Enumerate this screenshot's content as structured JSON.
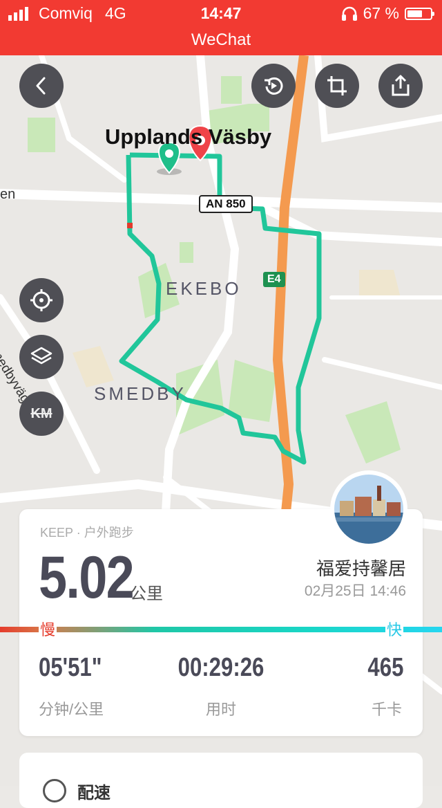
{
  "status_bar": {
    "carrier": "Comviq",
    "network": "4G",
    "time": "14:47",
    "battery_text": "67 %",
    "battery_level": 0.67,
    "app_title": "WeChat"
  },
  "map": {
    "place_title": "Upplands Väsby",
    "areas": [
      "EKEBO",
      "SMEDBY"
    ],
    "street_labels": [
      "Smedbyvägen",
      "en"
    ],
    "road_shield": "AN 850",
    "highway": "E4",
    "buttons": {
      "back": "back-icon",
      "replay": "replay-icon",
      "crop": "crop-icon",
      "share": "share-icon",
      "locate": "crosshair-icon",
      "layers": "layers-icon",
      "km": "KM"
    }
  },
  "summary": {
    "source": "KEEP · 户外跑步",
    "distance": "5.02",
    "distance_unit": "公里",
    "location": "福爱持馨居",
    "datetime": "02月25日 14:46",
    "speed_slow": "慢",
    "speed_fast": "快",
    "stats": [
      {
        "value": "05'51\"",
        "label": "分钟/公里"
      },
      {
        "value": "00:29:26",
        "label": "用时"
      },
      {
        "value": "465",
        "label": "千卡"
      }
    ]
  },
  "next_card": {
    "label": "配速"
  },
  "colors": {
    "status_bar_bg": "#f23a32",
    "route": "#21c69a",
    "highway": "#f49a4f",
    "slow": "#e53c2c",
    "fast": "#26d6f0"
  }
}
